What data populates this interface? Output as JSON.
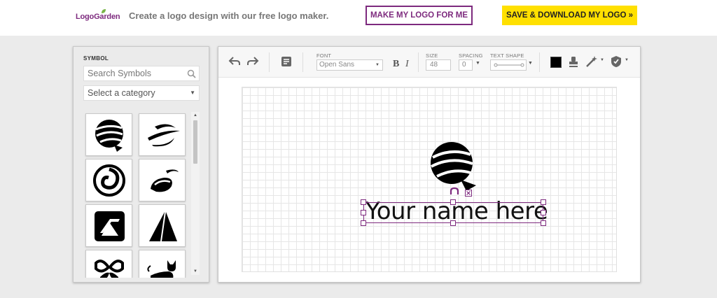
{
  "header": {
    "logo_text": "LogoGarden",
    "tagline": "Create a logo design with our free logo maker.",
    "make_button": "MAKE MY LOGO FOR ME",
    "save_button": "SAVE & DOWNLOAD MY LOGO »"
  },
  "symbol_panel": {
    "title": "SYMBOL",
    "search_placeholder": "Search Symbols",
    "category_value": "Select a category",
    "symbols": [
      "globe-swoosh",
      "orbit-swoosh",
      "spiral-circle",
      "leaf-swoosh",
      "stripe-square",
      "peaks",
      "butterfly",
      "cat"
    ]
  },
  "toolbar": {
    "font_label": "FONT",
    "font_value": "Open Sans",
    "bold_label": "B",
    "italic_label": "I",
    "size_label": "SIZE",
    "size_value": "48",
    "spacing_label": "SPACING",
    "spacing_value": "0",
    "text_shape_label": "TEXT SHAPE",
    "text_color": "#000000"
  },
  "canvas": {
    "text": "Your name here"
  },
  "colors": {
    "brand": "#7d2a7e",
    "accent_yellow": "#ffe000"
  }
}
